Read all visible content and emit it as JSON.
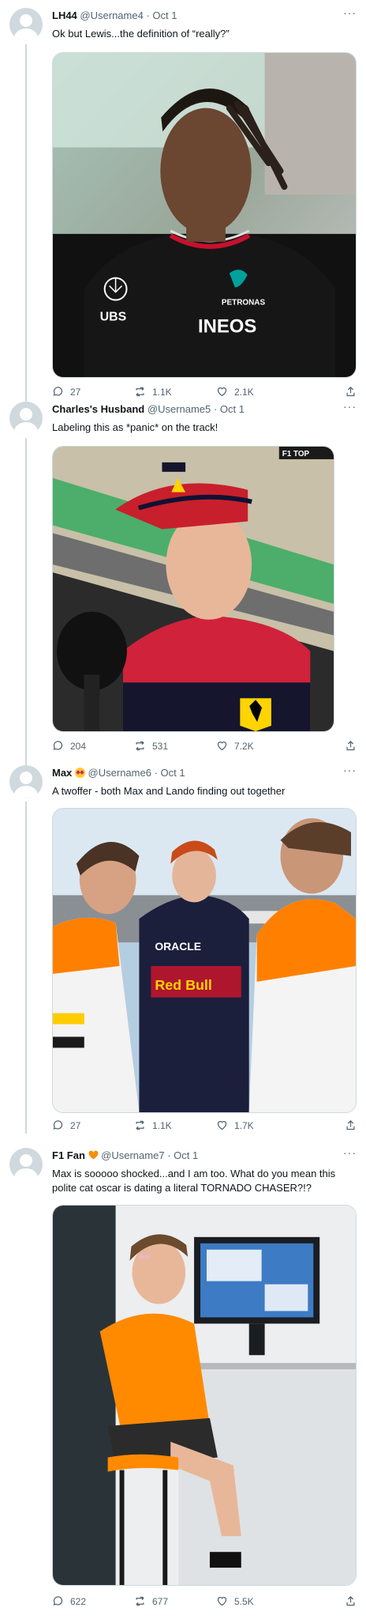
{
  "tweets": [
    {
      "name": "LH44",
      "handle": "@Username4",
      "date": "Oct 1",
      "text": "Ok but Lewis...the definition of “really?”",
      "media_alt": "Lewis Hamilton interview photo",
      "replies": "27",
      "retweets": "1.1K",
      "likes": "2.1K"
    },
    {
      "name": "Charles's Husband",
      "handle": "@Username5",
      "date": "Oct 1",
      "text": "Labeling this as *panic* on the track!",
      "media_alt": "Charles Leclerc interview photo",
      "media_badge": "F1 TOP",
      "replies": "204",
      "retweets": "531",
      "likes": "7.2K"
    },
    {
      "name": "Max",
      "handle": "@Username6",
      "date": "Oct 1",
      "text": "A twoffer - both Max and Lando finding out together",
      "media_alt": "Max and Lando photo",
      "replies": "27",
      "retweets": "1.1K",
      "likes": "1.7K"
    },
    {
      "name": "F1 Fan",
      "handle": "@Username7",
      "date": "Oct 1",
      "text": "Max is sooooo shocked...and I am too. What do you mean this polite cat oscar is dating a literal TORNADO CHASER?!?",
      "media_alt": "Oscar Piastri photo",
      "replies": "622",
      "retweets": "677",
      "likes": "5.5K"
    }
  ],
  "separator": "·",
  "more_label": "···",
  "colors": {
    "text": "#0f1419",
    "muted": "#536471",
    "border": "#cfd9de",
    "emoji_heart": "#f4900c"
  }
}
